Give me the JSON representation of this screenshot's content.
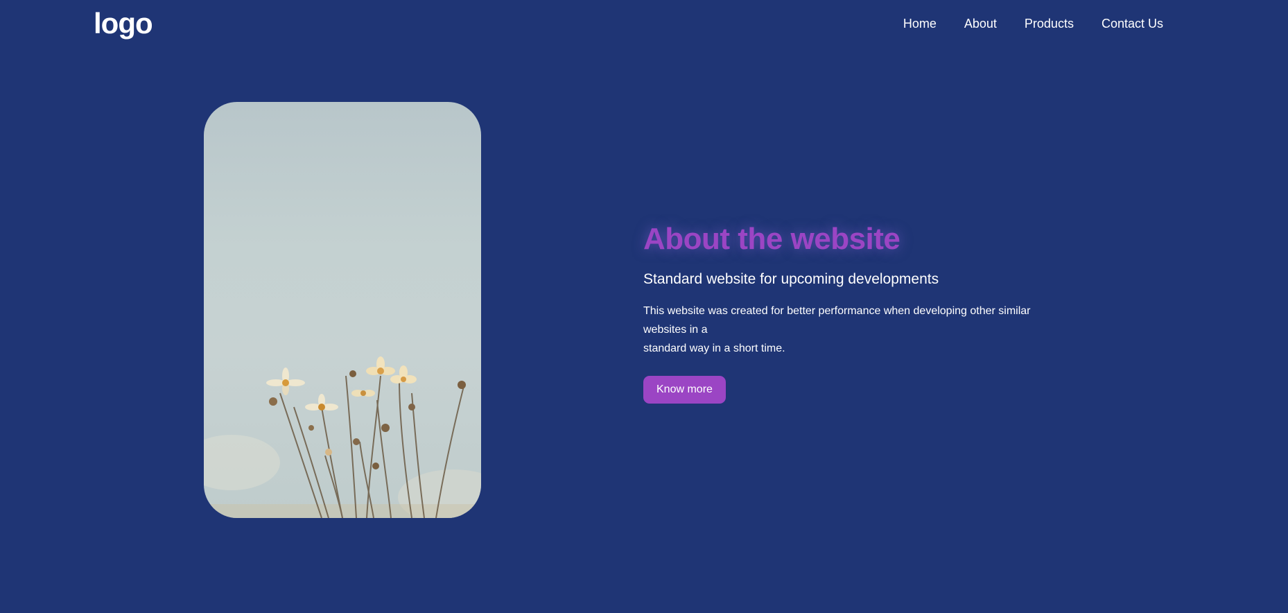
{
  "header": {
    "logo": "logo",
    "nav": [
      {
        "label": "Home"
      },
      {
        "label": "About"
      },
      {
        "label": "Products"
      },
      {
        "label": "Contact Us"
      }
    ]
  },
  "hero": {
    "image_alt_subject": "flowers-photo",
    "title": "About the website",
    "subtitle": "Standard website for upcoming developments",
    "description_lines": [
      "This website was created for better performance when developing other similar",
      "websites in a",
      "standard way in a short time."
    ],
    "button_label": "Know more"
  },
  "colors": {
    "background": "#1f3575",
    "accent": "#9b45c4",
    "text": "#ffffff"
  }
}
